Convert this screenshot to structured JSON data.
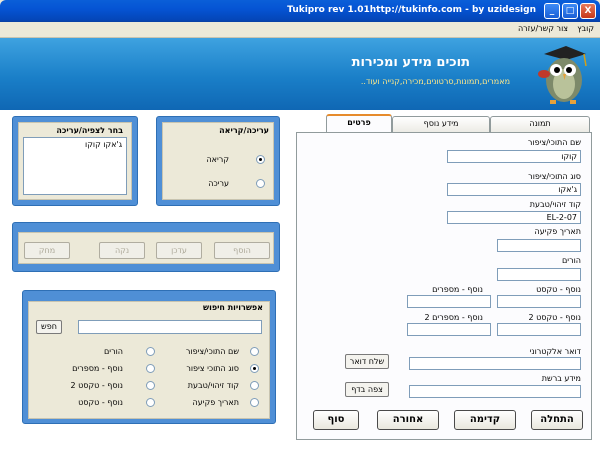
{
  "window": {
    "title": "Tukipro rev 1.01http://tukinfo.com - by uzidesign",
    "minimize": "_",
    "maximize": "□",
    "close": "X"
  },
  "menu": {
    "file": "קובץ",
    "help": "צור קשר/עזרה"
  },
  "header": {
    "title": "תוכים מידע ומכירות",
    "subtitle": "..מאמרים,תמונות,סרטונים,מכירה,קנייה ועוד"
  },
  "view_panel": {
    "title": "בחר לצפיה/עריכה",
    "list_items": [
      "ג'אקו קוקו"
    ]
  },
  "mode_panel": {
    "title": "עריכה/קריאה",
    "options": [
      {
        "label": "קריאה",
        "selected": true
      },
      {
        "label": "עריכה",
        "selected": false
      }
    ]
  },
  "action_buttons": {
    "add": "הוסף",
    "update": "עדכן",
    "clear": "נקה",
    "delete": "מחק"
  },
  "search_panel": {
    "title": "אפשרויות חיפוש",
    "search_button": "חפש",
    "search_value": "",
    "options_right": [
      {
        "label": "שם התוכי/ציפור",
        "selected": false
      },
      {
        "label": "סוג התוכי ציפור",
        "selected": true
      },
      {
        "label": "קוד זיהוי/טבעת",
        "selected": false
      },
      {
        "label": "תאריך פקיעה",
        "selected": false
      }
    ],
    "options_left": [
      {
        "label": "הורים",
        "selected": false
      },
      {
        "label": "נוסף - מספרים",
        "selected": false
      },
      {
        "label": "נוסף - טקסט 2",
        "selected": false
      },
      {
        "label": "נוסף - טקסט",
        "selected": false
      }
    ]
  },
  "tabs": {
    "details": "פרטים",
    "extra_info": "מידע נוסף",
    "image": "תמונה"
  },
  "form": {
    "name_label": "שם התוכי/ציפור",
    "name_value": "קוקו",
    "type_label": "סוג התוכי/ציפור",
    "type_value": "ג'אקו",
    "code_label": "קוד זיהוי/טבעת",
    "code_value": "EL-2-07",
    "date_label": "תאריך פקיעה",
    "date_value": "",
    "parents_label": "הורים",
    "parents_value": "",
    "extra_text_label": "נוסף - טקסט",
    "extra_text_value": "",
    "extra_numbers_label": "נוסף - מספרים",
    "extra_numbers_value": "",
    "extra_text2_label": "נוסף - טקסט 2",
    "extra_text2_value": "",
    "extra_numbers2_label": "נוסף - מספרים 2",
    "extra_numbers2_value": "",
    "email_label": "דואר אלקטרוני",
    "email_value": "",
    "send_mail_button": "שלח דואר",
    "web_label": "מידע ברשת",
    "web_value": "",
    "view_page_button": "צפה בדף"
  },
  "nav_buttons": {
    "start": "התחלה",
    "next": "קדימה",
    "back": "אחורה",
    "end": "סוף"
  }
}
